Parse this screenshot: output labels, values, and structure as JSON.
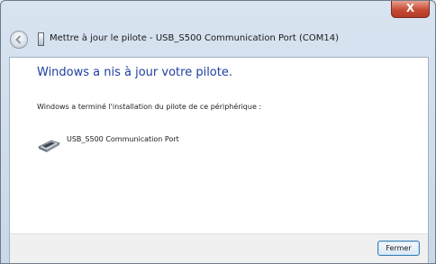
{
  "window": {
    "title": "Mettre à jour le pilote - USB_S500 Communication Port (COM14)",
    "close_glyph": "X"
  },
  "content": {
    "heading": "Windows a nis à jour votre pilote.",
    "message": "Windows a terminé l'installation du pilote de ce périphérique :",
    "device_name": "USB_S500 Communication Port"
  },
  "footer": {
    "close_label": "Fermer"
  },
  "colors": {
    "heading": "#1f3f9f",
    "close_button_red": "#c74a35",
    "button_border": "#3c7fb1"
  },
  "icons": {
    "back": "back-arrow-icon",
    "title_device": "device-icon",
    "device": "serial-port-icon"
  }
}
